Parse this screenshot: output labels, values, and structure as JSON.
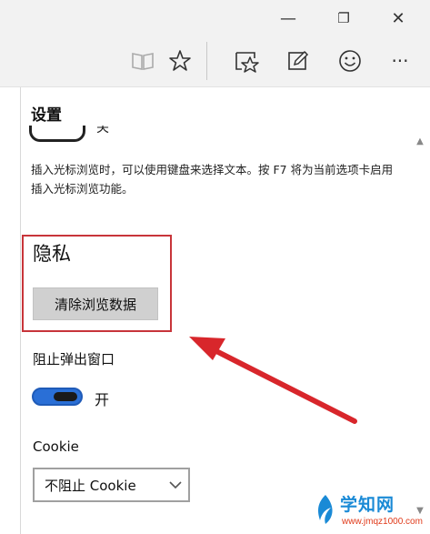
{
  "window": {
    "minimize_glyph": "—",
    "restore_glyph": "❐",
    "close_glyph": "✕"
  },
  "toolbar": {
    "icons": [
      "reading-view-icon",
      "favorite-star-icon",
      "hub-favorites-icon",
      "web-note-icon",
      "feedback-smiley-icon",
      "more-dots-icon"
    ],
    "more_glyph": "···"
  },
  "settings": {
    "title": "设置",
    "partial_toggle_label": "关",
    "caret_description": "插入光标浏览时，可以使用键盘来选择文本。按 F7 将为当前选项卡启用插入光标浏览功能。",
    "privacy": {
      "heading": "隐私",
      "clear_button": "清除浏览数据"
    },
    "popup": {
      "label": "阻止弹出窗口",
      "state": "开",
      "enabled": true
    },
    "cookie": {
      "label": "Cookie",
      "selected": "不阻止 Cookie"
    }
  },
  "colors": {
    "highlight_box": "#c8353a",
    "arrow": "#d8262b",
    "toggle_on": "#2a6fd6"
  },
  "watermark": {
    "title": "学知网",
    "url": "www.jmqz1000.com"
  }
}
